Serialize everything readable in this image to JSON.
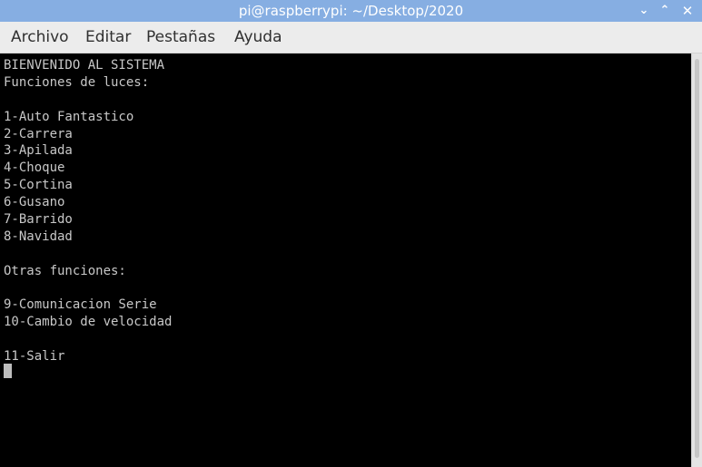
{
  "window": {
    "title": "pi@raspberrypi: ~/Desktop/2020",
    "minimize_glyph": "⌄",
    "maximize_glyph": "⌃",
    "close_glyph": "✕"
  },
  "menu": {
    "items": [
      "Archivo",
      "Editar",
      "Pestañas",
      "Ayuda"
    ]
  },
  "terminal": {
    "lines": [
      "BIENVENIDO AL SISTEMA",
      "Funciones de luces:",
      "",
      "1-Auto Fantastico",
      "2-Carrera",
      "3-Apilada",
      "4-Choque",
      "5-Cortina",
      "6-Gusano",
      "7-Barrido",
      "8-Navidad",
      "",
      "Otras funciones:",
      "",
      "9-Comunicacion Serie",
      "10-Cambio de velocidad",
      "",
      "11-Salir"
    ]
  },
  "colors": {
    "titlebar": "#86aee2",
    "terminal_bg": "#000000",
    "terminal_fg": "#c8c8c8"
  }
}
